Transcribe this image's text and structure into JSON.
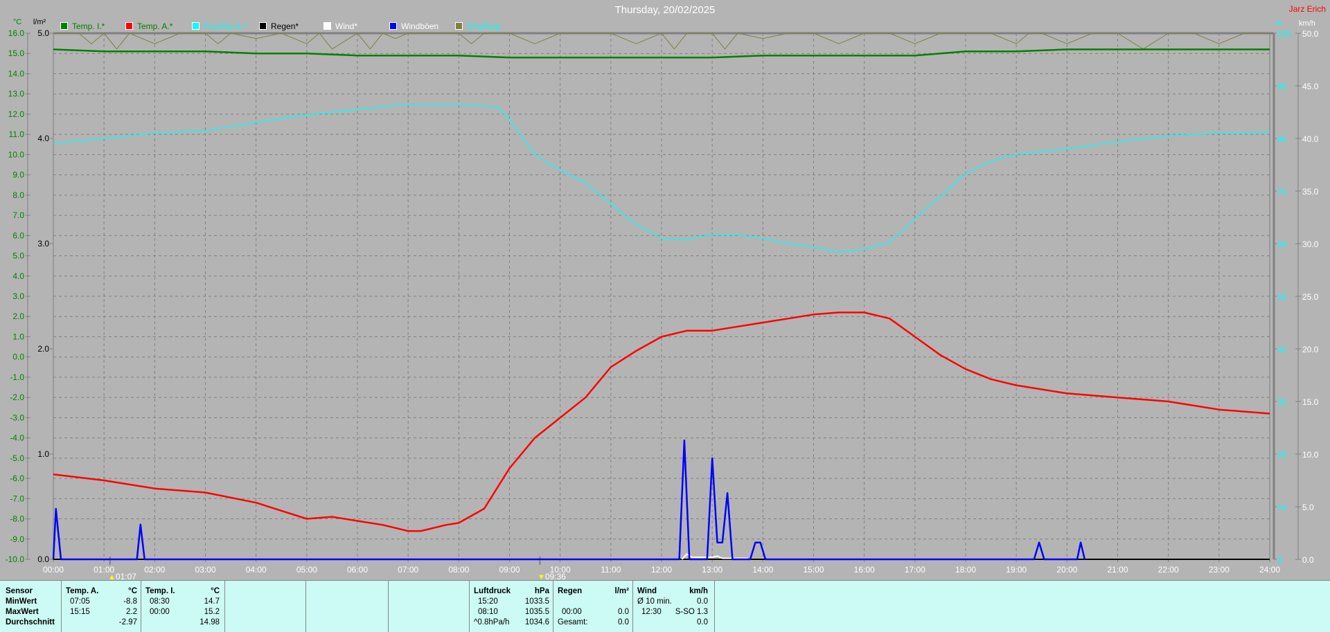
{
  "chart_data": {
    "type": "line",
    "title": "Thursday, 20/02/2025",
    "author": "Jarz Erich",
    "x_unit": "hours",
    "xlim": [
      0,
      24
    ],
    "x_ticks": [
      "00:00",
      "01:00",
      "02:00",
      "03:00",
      "04:00",
      "05:00",
      "06:00",
      "07:00",
      "08:00",
      "09:00",
      "10:00",
      "11:00",
      "12:00",
      "13:00",
      "14:00",
      "15:00",
      "16:00",
      "17:00",
      "18:00",
      "19:00",
      "20:00",
      "21:00",
      "22:00",
      "23:00",
      "24:00"
    ],
    "axes": {
      "temp": {
        "unit": "°C",
        "ylim": [
          -10,
          16
        ],
        "ticks": [
          "16.0",
          "15.0",
          "14.0",
          "13.0",
          "12.0",
          "11.0",
          "10.0",
          "9.0",
          "8.0",
          "7.0",
          "6.0",
          "5.0",
          "4.0",
          "3.0",
          "2.0",
          "1.0",
          "0.0",
          "-1.0",
          "-2.0",
          "-3.0",
          "-4.0",
          "-5.0",
          "-6.0",
          "-7.0",
          "-8.0",
          "-9.0",
          "-10.0"
        ],
        "color": "#008000"
      },
      "rain": {
        "unit": "l/m²",
        "ylim": [
          0,
          5
        ],
        "ticks": [
          "5.0",
          "4.0",
          "3.0",
          "2.0",
          "1.0",
          "0.0"
        ],
        "color": "#000000"
      },
      "humidity": {
        "unit": "%",
        "ylim": [
          0,
          100
        ],
        "ticks": [
          "100",
          "90",
          "80",
          "70",
          "60",
          "50",
          "40",
          "30",
          "20",
          "10",
          "0"
        ],
        "color": "#00ffff"
      },
      "wind": {
        "unit": "km/h",
        "ylim": [
          0,
          50
        ],
        "ticks": [
          "50.0",
          "45.0",
          "40.0",
          "35.0",
          "30.0",
          "25.0",
          "20.0",
          "15.0",
          "10.0",
          "5.0",
          "0.0"
        ],
        "color": "#ffffff"
      }
    },
    "grid": true,
    "legend": [
      {
        "label": "Temp. I.*",
        "color": "#008000",
        "text_color": "#008000"
      },
      {
        "label": "Temp. A.*",
        "color": "#ff0000",
        "text_color": "#008000"
      },
      {
        "label": "Feuchte A.*",
        "color": "#00ffff",
        "text_color": "#00ffff"
      },
      {
        "label": "Regen*",
        "color": "#000000",
        "text_color": "#000000"
      },
      {
        "label": "Wind*",
        "color": "#ffffff",
        "text_color": "#ffffff"
      },
      {
        "label": "Windböen",
        "color": "#0000ff",
        "text_color": "#ffffff"
      },
      {
        "label": "Empfang",
        "color": "#808040",
        "text_color": "#00ffff"
      }
    ],
    "series": [
      {
        "name": "Temp. I.",
        "axis": "temp",
        "color": "#008000",
        "x": [
          0,
          1,
          2,
          3,
          4,
          5,
          6,
          7,
          8,
          9,
          10,
          11,
          12,
          13,
          14,
          15,
          16,
          17,
          18,
          19,
          20,
          21,
          22,
          23,
          24
        ],
        "y": [
          15.2,
          15.1,
          15.1,
          15.1,
          15.0,
          15.0,
          14.9,
          14.9,
          14.9,
          14.8,
          14.8,
          14.8,
          14.8,
          14.8,
          14.9,
          14.9,
          14.9,
          14.9,
          15.1,
          15.1,
          15.2,
          15.2,
          15.2,
          15.2,
          15.2
        ]
      },
      {
        "name": "Temp. A.",
        "axis": "temp",
        "color": "#ff0000",
        "x": [
          0,
          1,
          2,
          3,
          4,
          5,
          5.5,
          6,
          6.5,
          7,
          7.25,
          7.75,
          8,
          8.5,
          9,
          9.5,
          10,
          10.5,
          11,
          11.5,
          12,
          12.5,
          13,
          13.5,
          14,
          14.5,
          15,
          15.5,
          16,
          16.5,
          17,
          17.5,
          18,
          18.5,
          19,
          20,
          21,
          22,
          23,
          24
        ],
        "y": [
          -5.8,
          -6.1,
          -6.5,
          -6.7,
          -7.2,
          -8.0,
          -7.9,
          -8.1,
          -8.3,
          -8.6,
          -8.6,
          -8.3,
          -8.2,
          -7.5,
          -5.5,
          -4.0,
          -3.0,
          -2.0,
          -0.5,
          0.3,
          1.0,
          1.3,
          1.3,
          1.5,
          1.7,
          1.9,
          2.1,
          2.2,
          2.2,
          1.9,
          1.0,
          0.1,
          -0.6,
          -1.1,
          -1.4,
          -1.8,
          -2.0,
          -2.2,
          -2.6,
          -2.8
        ]
      },
      {
        "name": "Feuchte A.",
        "axis": "humidity",
        "color": "#00ffff",
        "x": [
          0,
          1,
          2,
          3,
          4,
          5,
          6,
          7,
          8,
          8.75,
          9,
          9.5,
          10,
          10.5,
          11,
          11.5,
          12,
          12.5,
          13,
          13.5,
          14,
          14.5,
          15,
          15.5,
          16,
          16.5,
          17,
          17.5,
          18,
          18.5,
          19,
          20,
          21,
          22,
          23,
          24
        ],
        "y": [
          79,
          80,
          81,
          81.5,
          83,
          84.5,
          85.5,
          86.5,
          86.5,
          86,
          83.7,
          77,
          74,
          71.5,
          67.6,
          63.6,
          61,
          60.8,
          61.7,
          61.7,
          61,
          60,
          59.4,
          58.4,
          58.9,
          60.3,
          64.7,
          69,
          73.3,
          75.7,
          77,
          78,
          79.4,
          80.5,
          81,
          81.2
        ]
      },
      {
        "name": "Windböen",
        "axis": "wind",
        "color": "#0000ff",
        "x": [
          0,
          0.05,
          0.15,
          0.2,
          1.65,
          1.72,
          1.8,
          12.35,
          12.45,
          12.55,
          12.9,
          13.0,
          13.1,
          13.2,
          13.3,
          13.4,
          13.75,
          13.85,
          13.95,
          14.05,
          19.35,
          19.45,
          19.55,
          20.2,
          20.27,
          20.35
        ],
        "y": [
          0,
          4.8,
          0,
          0,
          0,
          3.3,
          0,
          0,
          11.3,
          0,
          0,
          9.6,
          1.6,
          1.6,
          6.3,
          0,
          0,
          1.6,
          1.6,
          0,
          0,
          1.6,
          0,
          0,
          1.6,
          0
        ]
      },
      {
        "name": "Wind",
        "axis": "wind",
        "color": "#ffffff",
        "x": [
          12.4,
          12.5,
          12.6,
          13.0,
          13.1,
          13.2,
          13.7
        ],
        "y": [
          0,
          0.5,
          0.2,
          0.2,
          0.3,
          0.1,
          0.1
        ]
      },
      {
        "name": "Regen",
        "axis": "rain",
        "color": "#000000",
        "x": [
          0,
          24
        ],
        "y": [
          0,
          0
        ]
      },
      {
        "name": "Empfang",
        "axis": "humidity",
        "color": "#808040",
        "x": [
          0,
          0.5,
          0.75,
          1,
          1.25,
          1.5,
          2,
          2.5,
          3,
          3.25,
          3.5,
          4,
          4.5,
          5,
          5.25,
          5.5,
          6,
          6.25,
          6.5,
          6.75,
          7,
          7.5,
          8,
          8.25,
          8.5,
          9,
          9.5,
          10,
          10.5,
          11,
          11.5,
          12,
          12.25,
          12.5,
          13,
          13.25,
          13.5,
          14,
          14.5,
          15,
          15.5,
          16,
          16.5,
          17,
          17.5,
          18,
          18.5,
          19,
          19.25,
          19.5,
          20,
          20.5,
          21,
          21.5,
          22,
          22.5,
          23,
          23.5,
          24
        ],
        "y": [
          100,
          100,
          98,
          100,
          97,
          100,
          98,
          100,
          100,
          98,
          100,
          99,
          100,
          98,
          100,
          97,
          100,
          97,
          100,
          99,
          100,
          100,
          100,
          98,
          100,
          100,
          98,
          100,
          100,
          100,
          98,
          100,
          97,
          100,
          100,
          97,
          100,
          99,
          100,
          100,
          98,
          100,
          100,
          98,
          100,
          100,
          100,
          98,
          100,
          100,
          98,
          100,
          100,
          97,
          100,
          100,
          98,
          100,
          100
        ]
      }
    ],
    "annotations": [
      {
        "time": "01:07",
        "icon": "sunrise-marker-icon"
      },
      {
        "time": "09:36",
        "icon": "sunset-marker-icon"
      }
    ]
  },
  "summary": {
    "sensor": {
      "header": "Sensor",
      "rows": [
        "MinWert",
        "MaxWert",
        "Durchschnitt"
      ]
    },
    "temp_a": {
      "header": "Temp. A.",
      "unit": "°C",
      "min_time": "07:05",
      "min": "-8.8",
      "max_time": "15:15",
      "max": "2.2",
      "avg": "-2.97"
    },
    "temp_i": {
      "header": "Temp. I.",
      "unit": "°C",
      "min_time": "08:30",
      "min": "14.7",
      "max_time": "00:00",
      "max": "15.2",
      "avg": "14.98"
    },
    "pressure": {
      "header": "Luftdruck",
      "unit": "hPa",
      "min_time": "15:20",
      "min": "1033.5",
      "max_time": "08:10",
      "max": "1035.5",
      "trend": "^0.8hPa/h",
      "avg": "1034.6"
    },
    "rain": {
      "header": "Regen",
      "unit": "l/m²",
      "max_time": "00:00",
      "max": "0.0",
      "total_label": "Gesamt:",
      "total": "0.0"
    },
    "wind": {
      "header": "Wind",
      "unit": "km/h",
      "avg_label": "Ø 10 min.",
      "avg10": "0.0",
      "max_time": "12:30",
      "max": "S-SO 1.3",
      "avg": "0.0"
    }
  }
}
